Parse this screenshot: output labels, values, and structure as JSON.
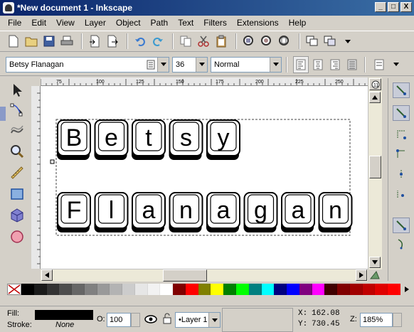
{
  "window": {
    "title": "*New document 1 - Inkscape",
    "min": "_",
    "max": "□",
    "close": "X"
  },
  "menu": [
    "File",
    "Edit",
    "View",
    "Layer",
    "Object",
    "Path",
    "Text",
    "Filters",
    "Extensions",
    "Help"
  ],
  "textbar": {
    "font_family": "Betsy Flanagan",
    "font_size": "36",
    "font_style": "Normal"
  },
  "canvas": {
    "line1": [
      "B",
      "e",
      "t",
      "s",
      "y"
    ],
    "line2": [
      "F",
      "l",
      "a",
      "n",
      "a",
      "g",
      "a",
      "n"
    ]
  },
  "ruler": {
    "marks": [
      "75",
      "100",
      "125",
      "150",
      "175",
      "200",
      "225",
      "250"
    ]
  },
  "palette": [
    "#000000",
    "#1a1a1a",
    "#333333",
    "#4d4d4d",
    "#666666",
    "#808080",
    "#999999",
    "#b3b3b3",
    "#cccccc",
    "#e6e6e6",
    "#f2f2f2",
    "#ffffff",
    "#800000",
    "#ff0000",
    "#808000",
    "#ffff00",
    "#008000",
    "#00ff00",
    "#008080",
    "#00ffff",
    "#000080",
    "#0000ff",
    "#800080",
    "#ff00ff",
    "#400000",
    "#800000",
    "#a00000",
    "#c00000",
    "#e00000",
    "#ff0000"
  ],
  "status": {
    "fill_label": "Fill:",
    "stroke_label": "Stroke:",
    "stroke_value": "None",
    "opacity_label": "O:",
    "opacity_value": "100",
    "layer_value": "•Layer 1",
    "x_label": "X:",
    "x_value": "162.08",
    "y_label": "Y:",
    "y_value": "730.45",
    "zoom_label": "Z:",
    "zoom_value": "185%"
  }
}
